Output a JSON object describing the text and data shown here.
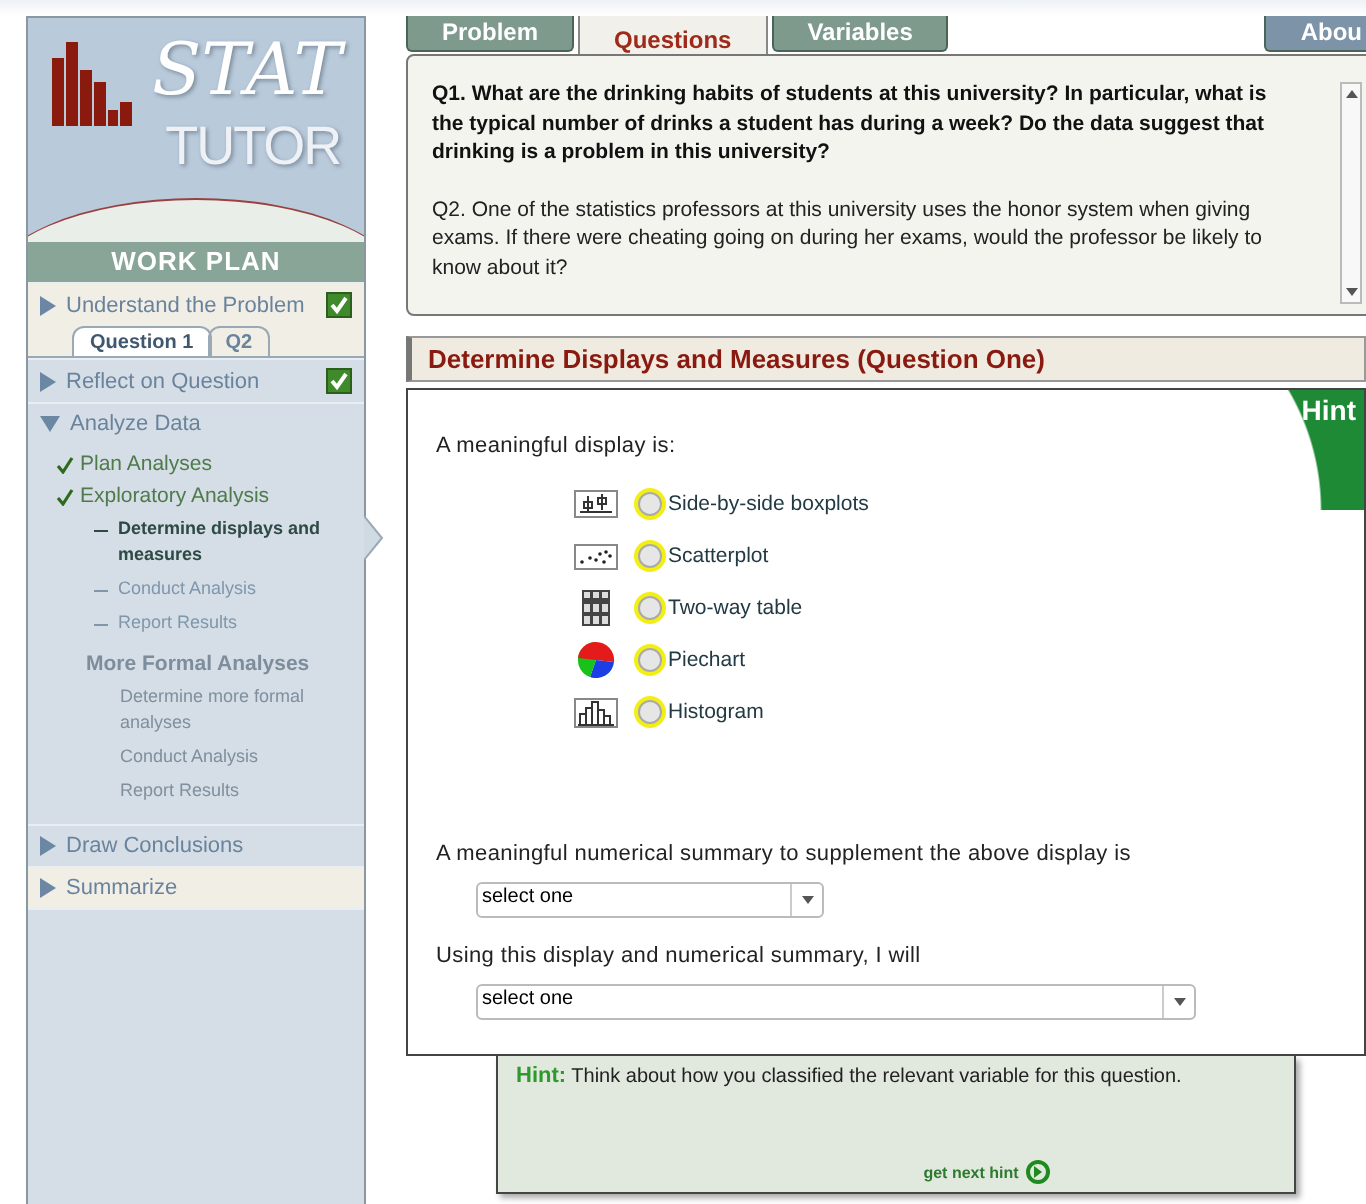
{
  "logo": {
    "line_1": "STAT",
    "line_2": "TUTOR",
    "band": "WORK PLAN"
  },
  "sidebar": {
    "sections": [
      {
        "label": "Understand the Problem",
        "expanded": false,
        "checked": true,
        "highlighted": true,
        "subtabs": [
          {
            "label": "Question 1",
            "selected": true
          },
          {
            "label": "Q2",
            "selected": false
          }
        ]
      },
      {
        "label": "Reflect on Question",
        "expanded": false,
        "checked": true,
        "highlighted": false
      },
      {
        "label": "Analyze Data",
        "expanded": true,
        "checked": false,
        "highlighted": false,
        "children": [
          {
            "label": "Plan Analyses",
            "done": true,
            "disabled": false
          },
          {
            "label": "Exploratory Analysis",
            "done": true,
            "disabled": false,
            "children": [
              {
                "label": "Determine displays and measures",
                "current": true,
                "disabled": false
              },
              {
                "label": "Conduct Analysis",
                "current": false,
                "disabled": false
              },
              {
                "label": "Report Results",
                "current": false,
                "disabled": false
              }
            ]
          },
          {
            "label": "More Formal Analyses",
            "done": false,
            "disabled": true,
            "children": [
              {
                "label": "Determine more formal analyses",
                "current": false,
                "disabled": true
              },
              {
                "label": "Conduct Analysis",
                "current": false,
                "disabled": true
              },
              {
                "label": "Report Results",
                "current": false,
                "disabled": true
              }
            ]
          }
        ]
      },
      {
        "label": "Draw Conclusions",
        "expanded": false,
        "checked": false,
        "highlighted": false
      },
      {
        "label": "Summarize",
        "expanded": false,
        "checked": false,
        "highlighted": true
      }
    ]
  },
  "tabs": [
    {
      "label": "Problem",
      "selected": false
    },
    {
      "label": "Questions",
      "selected": true
    },
    {
      "label": "Variables",
      "selected": false
    }
  ],
  "about_tab": {
    "label": "Abou"
  },
  "questions": [
    {
      "text": "Q1. What are the drinking habits of students at this university? In particular, what is the typical number of drinks a student has during a week? Do the data suggest that drinking is a problem in this university?",
      "bold": true
    },
    {
      "text": "Q2. One of the statistics professors at this university uses the honor system when giving exams. If there were cheating going on during her exams, would the professor be likely to know about it?",
      "bold": false
    }
  ],
  "section_title": "Determine Displays and Measures (Question One)",
  "hint_corner": "Hint",
  "display_prompt": "A meaningful display is:",
  "display_options": [
    {
      "label": "Side-by-side boxplots",
      "kind": "boxplot",
      "selected": false
    },
    {
      "label": "Scatterplot",
      "kind": "scatter",
      "selected": false
    },
    {
      "label": "Two-way table",
      "kind": "table",
      "selected": false
    },
    {
      "label": "Piechart",
      "kind": "pie",
      "selected": false
    },
    {
      "label": "Histogram",
      "kind": "histogram",
      "selected": false
    }
  ],
  "selects": [
    {
      "label": "A meaningful numerical summary to supplement the above display is",
      "value": "select one",
      "wide": false
    },
    {
      "label": "Using this display and numerical summary, I will",
      "value": "select one",
      "wide": true
    }
  ],
  "hint": {
    "label": "Hint:",
    "text": "Think about how you classified the relevant variable for this question.",
    "next": "get next hint"
  }
}
